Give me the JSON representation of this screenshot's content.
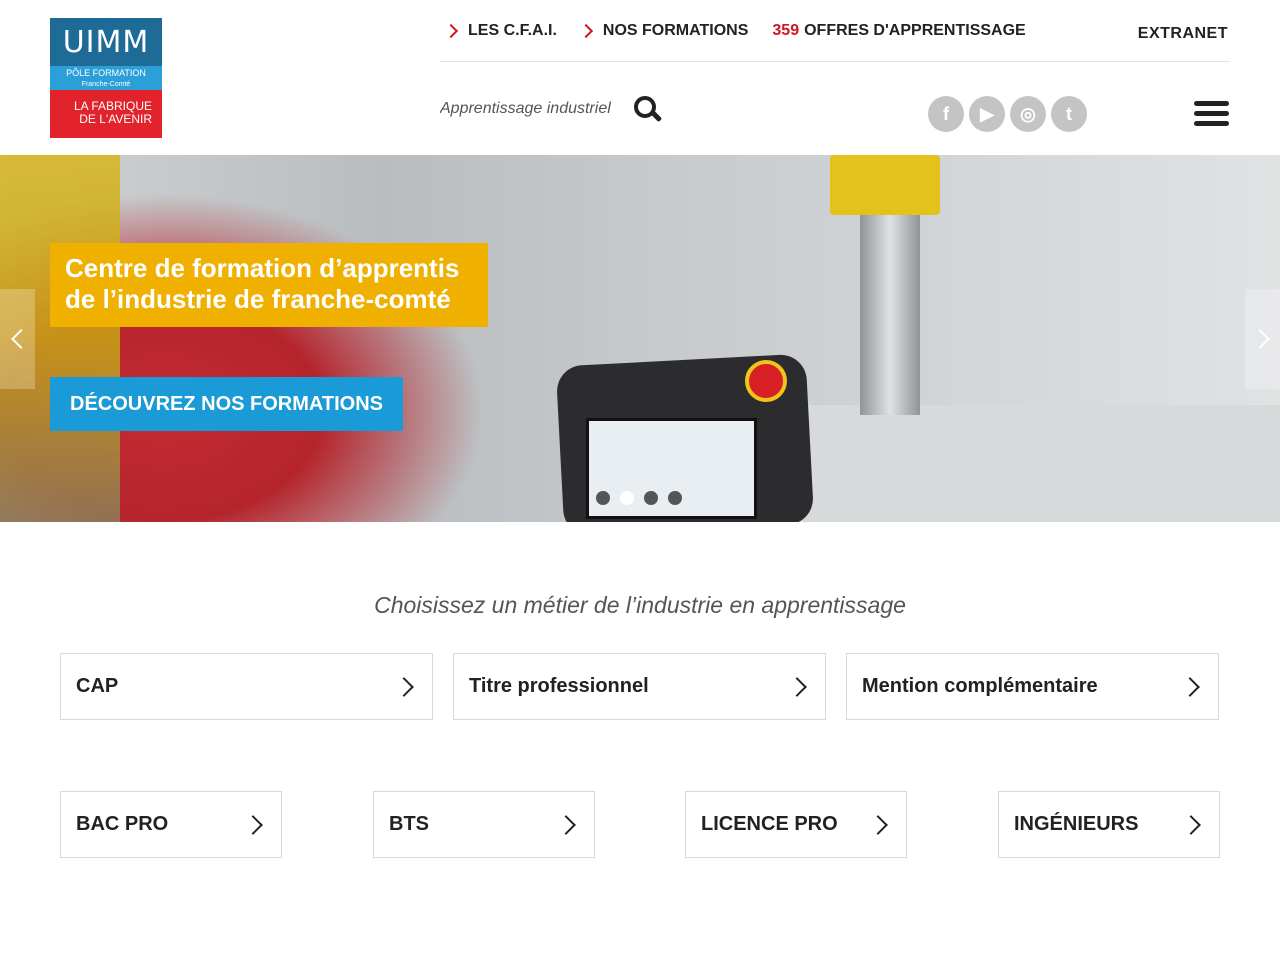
{
  "logo": {
    "brand": "UIMM",
    "pole": "PÔLE FORMATION",
    "region": "Franche-Comté",
    "tagline_1": "LA FABRIQUE",
    "tagline_2": "DE L'AVENIR"
  },
  "topnav": {
    "cfai": "LES C.F.A.I.",
    "formations": "NOS FORMATIONS",
    "offers_count": "359",
    "offers_label": "OFFRES D'APPRENTISSAGE",
    "extranet": "EXTRANET"
  },
  "search": {
    "placeholder": "Apprentissage industriel"
  },
  "socials": [
    {
      "name": "facebook-icon",
      "glyph": "f"
    },
    {
      "name": "youtube-icon",
      "glyph": "▶"
    },
    {
      "name": "instagram-icon",
      "glyph": "◎"
    },
    {
      "name": "twitter-icon",
      "glyph": "t"
    }
  ],
  "hero": {
    "title": "Centre de formation d’apprentis de l’industrie de franche-comté",
    "cta": "DÉCOUVREZ NOS FORMATIONS",
    "slides_total": 4,
    "active_slide": 2
  },
  "main": {
    "title": "Choisissez un métier de l’industrie en apprentissage",
    "cards_row1": [
      "CAP",
      "Titre professionnel",
      "Mention complémentaire"
    ],
    "cards_row2": [
      "BAC PRO",
      "BTS",
      "LICENCE PRO",
      "INGÉNIEURS"
    ]
  },
  "colors": {
    "accent_red": "#d0181f",
    "hero_yellow": "#efb000",
    "cta_blue": "#1a9ad6",
    "logo_blue": "#1e6b97",
    "logo_light_blue": "#2a9fd8",
    "logo_red": "#e3232c"
  }
}
